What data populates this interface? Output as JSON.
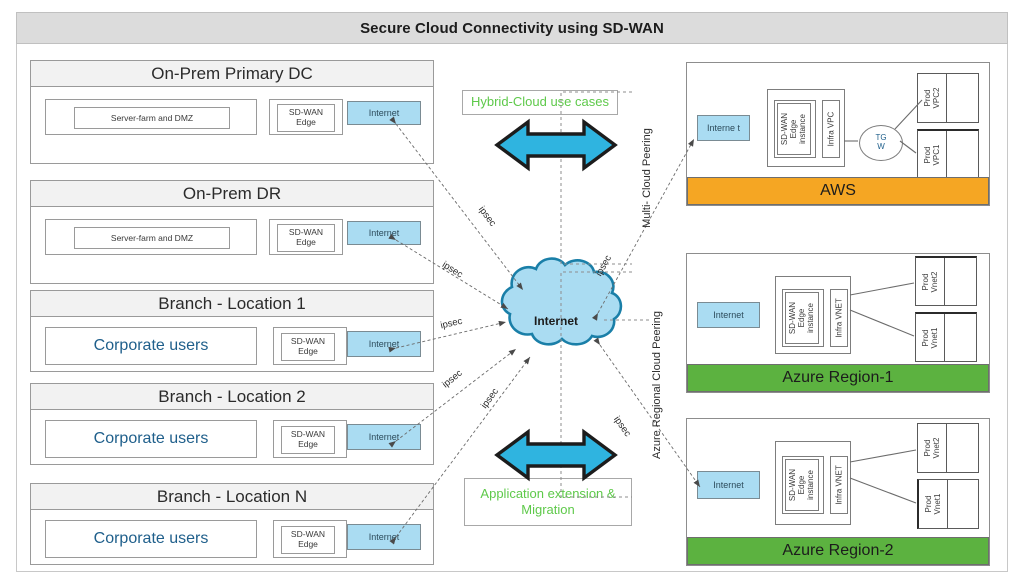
{
  "page": {
    "title": "Secure Cloud Connectivity using SD-WAN",
    "colors": {
      "title_bar_bg": "#dcdcdc",
      "internet_box": "#aadcf2",
      "cloud_fill": "#aadcf2",
      "cloud_stroke": "#1a7fa8",
      "aws_bar": "#f5a623",
      "azure_bar": "#5cb240",
      "callout_text": "#5ec94a",
      "corporate_users_text": "#1f5f8b",
      "arrow_fill": "#2fb4e0"
    }
  },
  "sites": [
    {
      "title": "On-Prem Primary DC",
      "inner_label": "Server-farm  and DMZ",
      "inner_kind": "server-farm",
      "edge_label_line1": "SD-WAN",
      "edge_label_line2": "Edge",
      "internet_label": "Internet"
    },
    {
      "title": "On-Prem DR",
      "inner_label": "Server-farm  and DMZ",
      "inner_kind": "server-farm",
      "edge_label_line1": "SD-WAN",
      "edge_label_line2": "Edge",
      "internet_label": "Internet"
    },
    {
      "title": "Branch - Location 1",
      "inner_label": "Corporate users",
      "inner_kind": "corporate",
      "edge_label_line1": "SD-WAN",
      "edge_label_line2": "Edge",
      "internet_label": "Internet"
    },
    {
      "title": "Branch - Location 2",
      "inner_label": "Corporate users",
      "inner_kind": "corporate",
      "edge_label_line1": "SD-WAN",
      "edge_label_line2": "Edge",
      "internet_label": "Internet"
    },
    {
      "title": "Branch - Location N",
      "inner_label": "Corporate users",
      "inner_kind": "corporate",
      "edge_label_line1": "SD-WAN",
      "edge_label_line2": "Edge",
      "internet_label": "Internet"
    }
  ],
  "center": {
    "cloud_label": "Internet",
    "callout_top": "Hybrid-Cloud use cases",
    "callout_bottom_line1": "Application extension &",
    "callout_bottom_line2": "Migration",
    "ipsec_label": "ipsec",
    "ipsec_count": 6,
    "peering_top": "Multi- Cloud Peering",
    "peering_bottom": "Azure Regional Cloud Peering"
  },
  "clouds": [
    {
      "name": "AWS",
      "bar_color": "#f5a623",
      "internet_label": "Interne t",
      "edge_instance": "SD-WAN Edge instance",
      "infra": "Infra VPC",
      "hub_label": "TG W",
      "prod": [
        "Prod VPC2",
        "Prod VPC1"
      ]
    },
    {
      "name": "Azure Region-1",
      "bar_color": "#5cb240",
      "internet_label": "Internet",
      "edge_instance": "SD-WAN Edge instance",
      "infra": "Infra VNET",
      "hub_label": "",
      "prod": [
        "Prod Vnet2",
        "Prod Vnet1"
      ]
    },
    {
      "name": "Azure  Region-2",
      "bar_color": "#5cb240",
      "internet_label": "Internet",
      "edge_instance": "SD-WAN Edge instance",
      "infra": "Infra VNET",
      "hub_label": "",
      "prod": [
        "Prod Vnet2",
        "Prod Vnet1"
      ]
    }
  ]
}
